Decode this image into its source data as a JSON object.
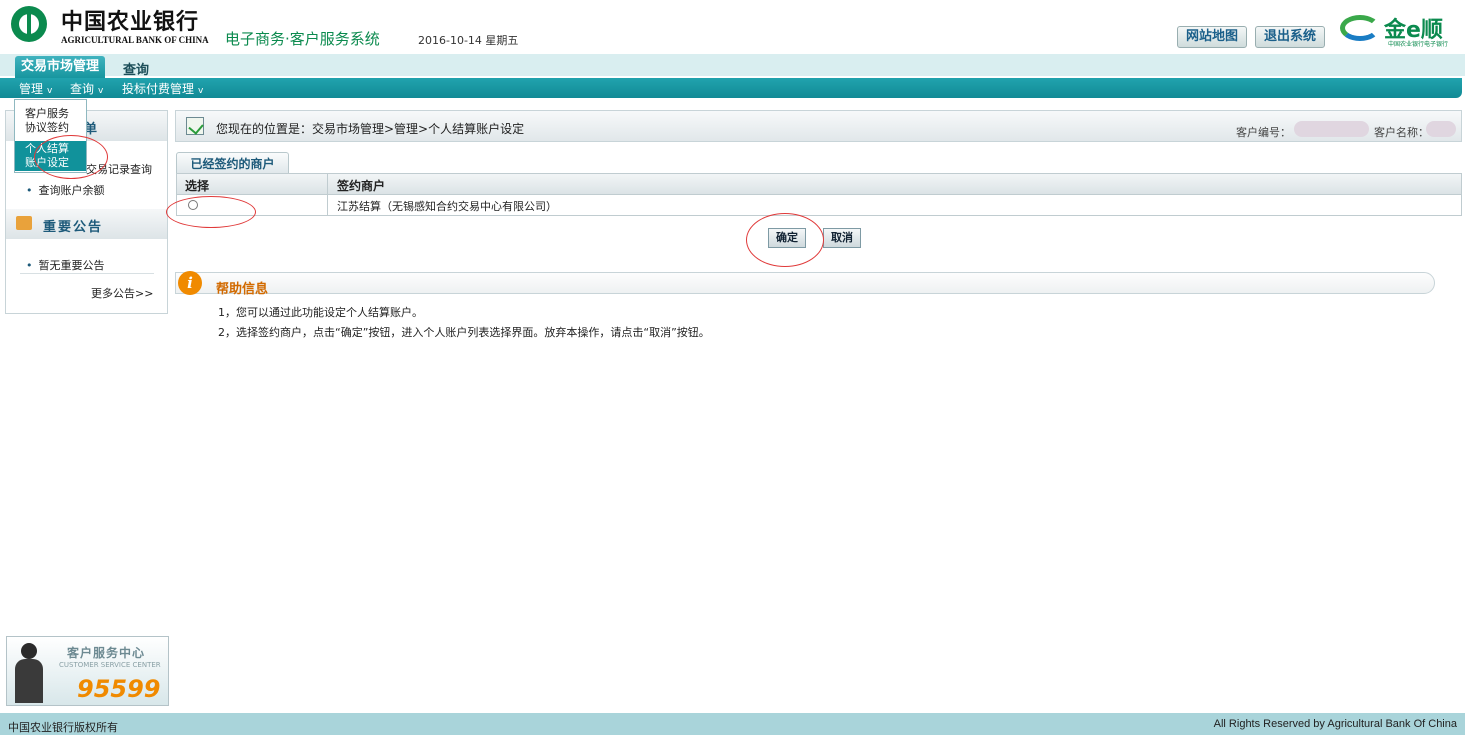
{
  "header": {
    "brand_cn": "中国农业银行",
    "brand_en": "AGRICULTURAL BANK OF CHINA",
    "system_title": "电子商务·客户服务系统",
    "date": "2016-10-14 星期五",
    "sitemap_label": "网站地图",
    "logout_label": "退出系统",
    "partner_logo_text": "金e顺",
    "partner_logo_sub": "中国农业银行电子银行"
  },
  "tabs": [
    {
      "label": "交易市场管理",
      "active": true
    },
    {
      "label": "查询",
      "active": false
    }
  ],
  "menu": [
    {
      "label": "管理"
    },
    {
      "label": "查询"
    },
    {
      "label": "投标付费管理"
    }
  ],
  "dropdown": {
    "items": [
      {
        "line1": "客户服务",
        "line2": "协议签约",
        "active": false
      },
      {
        "line1": "个人结算",
        "line2": "账户设定",
        "active": true
      }
    ]
  },
  "sidebar": {
    "menu_title": "单",
    "menu_items": [
      "交易记录查询",
      "查询账户余额"
    ],
    "notice_title": "重要公告",
    "notice_items": [
      "暂无重要公告"
    ],
    "more_label": "更多公告>>"
  },
  "breadcrumb": {
    "text": "您现在的位置是：交易市场管理>管理>个人结算账户设定",
    "customer_id_label": "客户编号：",
    "customer_name_label": "客户名称："
  },
  "merchant_tab": "已经签约的商户",
  "table": {
    "headers": [
      "选择",
      "签约商户"
    ],
    "rows": [
      {
        "merchant": "江苏结算（无锡感知合约交易中心有限公司）"
      }
    ]
  },
  "buttons": {
    "confirm": "确定",
    "cancel": "取消"
  },
  "help": {
    "title": "帮助信息",
    "lines": [
      "1，您可以通过此功能设定个人结算账户。",
      "2，选择签约商户，点击“确定”按钮，进入个人账户列表选择界面。放弃本操作，请点击“取消”按钮。"
    ]
  },
  "service_center": {
    "title": "客户服务中心",
    "subtitle": "CUSTOMER SERVICE CENTER",
    "phone": "95599"
  },
  "footer": {
    "left": "中国农业银行版权所有",
    "right": "All Rights Reserved by Agricultural Bank Of China"
  },
  "colors": {
    "brand_green": "#0b8a4e",
    "teal": "#11929b",
    "accent_orange": "#f08a00",
    "annotation_red": "#e03a3a"
  }
}
